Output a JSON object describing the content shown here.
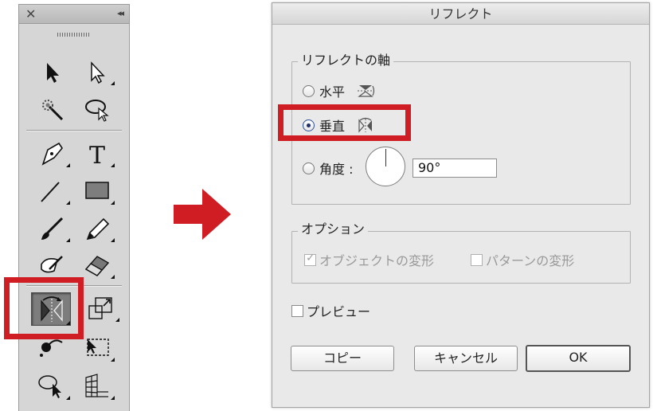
{
  "tools_panel": {
    "close_glyph": "✕",
    "collapse_glyph": "◂◂",
    "tools": [
      {
        "name": "selection-tool-icon"
      },
      {
        "name": "direct-selection-tool-icon"
      },
      {
        "name": "magic-wand-tool-icon"
      },
      {
        "name": "lasso-tool-icon"
      },
      {
        "name": "pen-tool-icon"
      },
      {
        "name": "type-tool-icon",
        "glyph": "T"
      },
      {
        "name": "line-segment-tool-icon"
      },
      {
        "name": "rectangle-tool-icon"
      },
      {
        "name": "paintbrush-tool-icon"
      },
      {
        "name": "pencil-tool-icon"
      },
      {
        "name": "blob-brush-tool-icon"
      },
      {
        "name": "eraser-tool-icon"
      },
      {
        "name": "reflect-tool-icon",
        "selected": true
      },
      {
        "name": "scale-tool-icon"
      },
      {
        "name": "puppet-warp-tool-icon"
      },
      {
        "name": "free-transform-tool-icon"
      },
      {
        "name": "shape-builder-tool-icon"
      },
      {
        "name": "perspective-grid-tool-icon"
      }
    ],
    "highlight_color": "#cf1d23"
  },
  "arrow": {
    "color": "#cf1d23",
    "icon": "right-arrow-icon"
  },
  "dialog": {
    "title": "リフレクト",
    "axis_group": {
      "label": "リフレクトの軸",
      "horizontal_label": "水平",
      "vertical_label": "垂直",
      "angle_label": "角度 :",
      "angle_value": "90°",
      "selected": "vertical"
    },
    "options_group": {
      "label": "オプション",
      "transform_objects_label": "オブジェクトの変形",
      "transform_objects_checked": true,
      "transform_patterns_label": "パターンの変形",
      "transform_patterns_checked": false
    },
    "preview_label": "プレビュー",
    "preview_checked": false,
    "copy_button": "コピー",
    "cancel_button": "キャンセル",
    "ok_button": "OK"
  }
}
